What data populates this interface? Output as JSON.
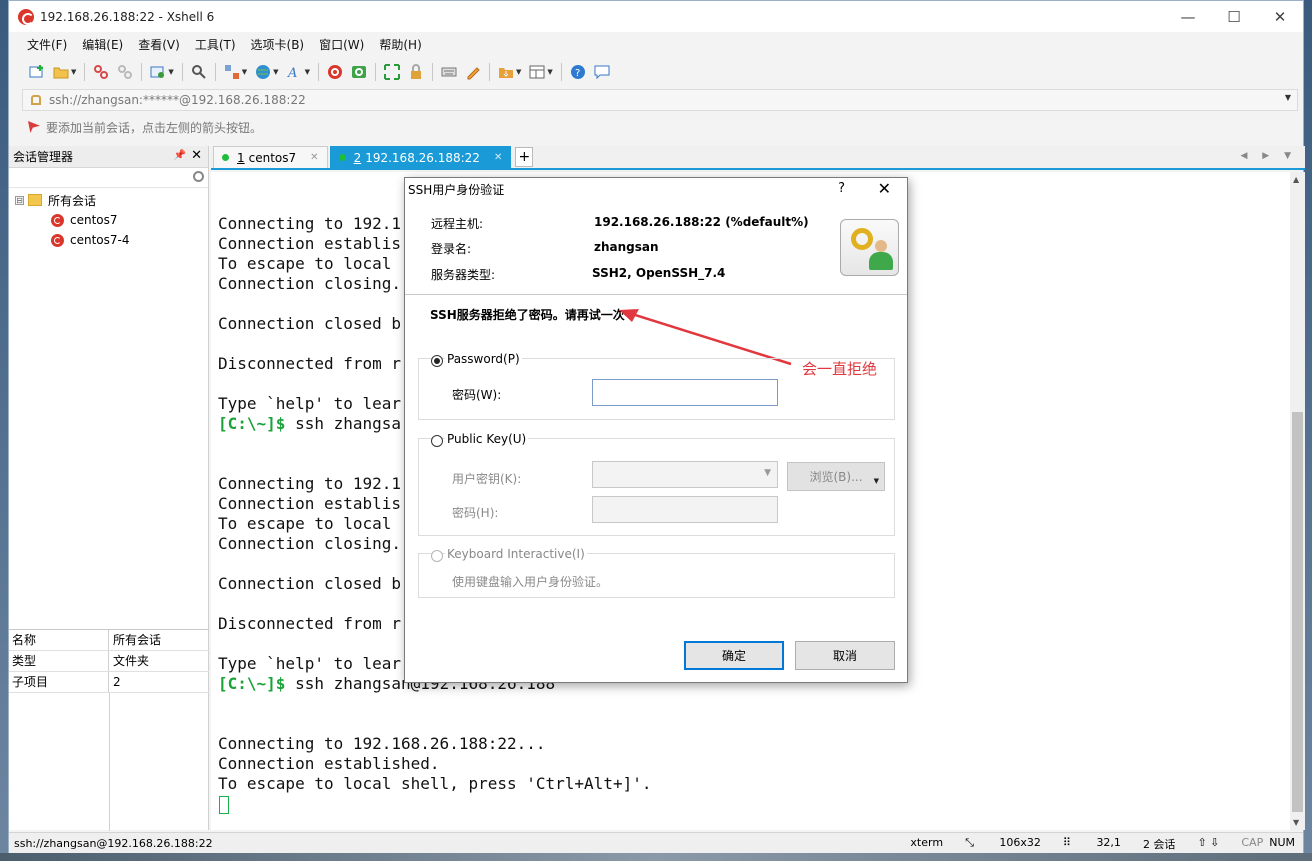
{
  "window": {
    "title": "192.168.26.188:22 - Xshell 6",
    "controls": [
      "—",
      "☐",
      "✕"
    ]
  },
  "menu": [
    "文件(F)",
    "编辑(E)",
    "查看(V)",
    "工具(T)",
    "选项卡(B)",
    "窗口(W)",
    "帮助(H)"
  ],
  "address": {
    "value": "ssh://zhangsan:******@192.168.26.188:22"
  },
  "hint": "要添加当前会话，点击左侧的箭头按钮。",
  "session_manager": {
    "title": "会话管理器",
    "tree": {
      "root": "所有会话",
      "expander": "⊟",
      "children": [
        "centos7",
        "centos7-4"
      ]
    },
    "properties": [
      {
        "key": "名称",
        "value": "所有会话"
      },
      {
        "key": "类型",
        "value": "文件夹"
      },
      {
        "key": "子项目",
        "value": "2"
      }
    ]
  },
  "tabs": [
    {
      "num": "1",
      "label": "centos7",
      "active": false
    },
    {
      "num": "2",
      "label": "192.168.26.188:22",
      "active": true
    }
  ],
  "terminal": {
    "lines": [
      {
        "t": "Connecting to 192.1"
      },
      {
        "t": "Connection establis"
      },
      {
        "t": "To escape to local "
      },
      {
        "t": "Connection closing."
      },
      {
        "t": ""
      },
      {
        "t": "Connection closed b"
      },
      {
        "t": ""
      },
      {
        "t": "Disconnected from r"
      },
      {
        "t": ""
      },
      {
        "t": "Type `help' to lear"
      },
      {
        "p": "[C:\\~]$",
        "t": " ssh zhangsa"
      },
      {
        "t": ""
      },
      {
        "t": ""
      },
      {
        "t": "Connecting to 192.1"
      },
      {
        "t": "Connection establis"
      },
      {
        "t": "To escape to local "
      },
      {
        "t": "Connection closing."
      },
      {
        "t": ""
      },
      {
        "t": "Connection closed b"
      },
      {
        "t": ""
      },
      {
        "t": "Disconnected from r"
      },
      {
        "t": ""
      },
      {
        "t": "Type `help' to lear"
      },
      {
        "p": "[C:\\~]$",
        "t": " ssh zhangsan@192.168.26.188"
      },
      {
        "t": ""
      },
      {
        "t": ""
      },
      {
        "t": "Connecting to 192.168.26.188:22..."
      },
      {
        "t": "Connection established."
      },
      {
        "t": "To escape to local shell, press 'Ctrl+Alt+]'."
      }
    ]
  },
  "dialog": {
    "title": "SSH用户身份验证",
    "help": "?",
    "close": "✕",
    "remote_host_label": "远程主机:",
    "remote_host": "192.168.26.188:22 (%default%)",
    "login_label": "登录名:",
    "login": "zhangsan",
    "server_type_label": "服务器类型:",
    "server_type": "SSH2, OpenSSH_7.4",
    "error": "SSH服务器拒绝了密码。请再试一次",
    "annotation": "会一直拒绝",
    "password_option": "Password(P)",
    "password_label": "密码(W):",
    "password_value": "",
    "publickey_option": "Public Key(U)",
    "user_key_label": "用户密钥(K):",
    "browse_label": "浏览(B)...",
    "passphrase_label": "密码(H):",
    "keyboard_option": "Keyboard Interactive(I)",
    "keyboard_desc": "使用键盘输入用户身份验证。",
    "ok": "确定",
    "cancel": "取消"
  },
  "status": {
    "left": "ssh://zhangsan@192.168.26.188:22",
    "term": "xterm",
    "size": "106x32",
    "pos": "32,1",
    "sessions": "2 会话",
    "caps": "CAP",
    "num": "NUM"
  },
  "colors": {
    "accent": "#1a9bd7",
    "prompt": "#1aa33a",
    "annotation": "#e0383e"
  }
}
